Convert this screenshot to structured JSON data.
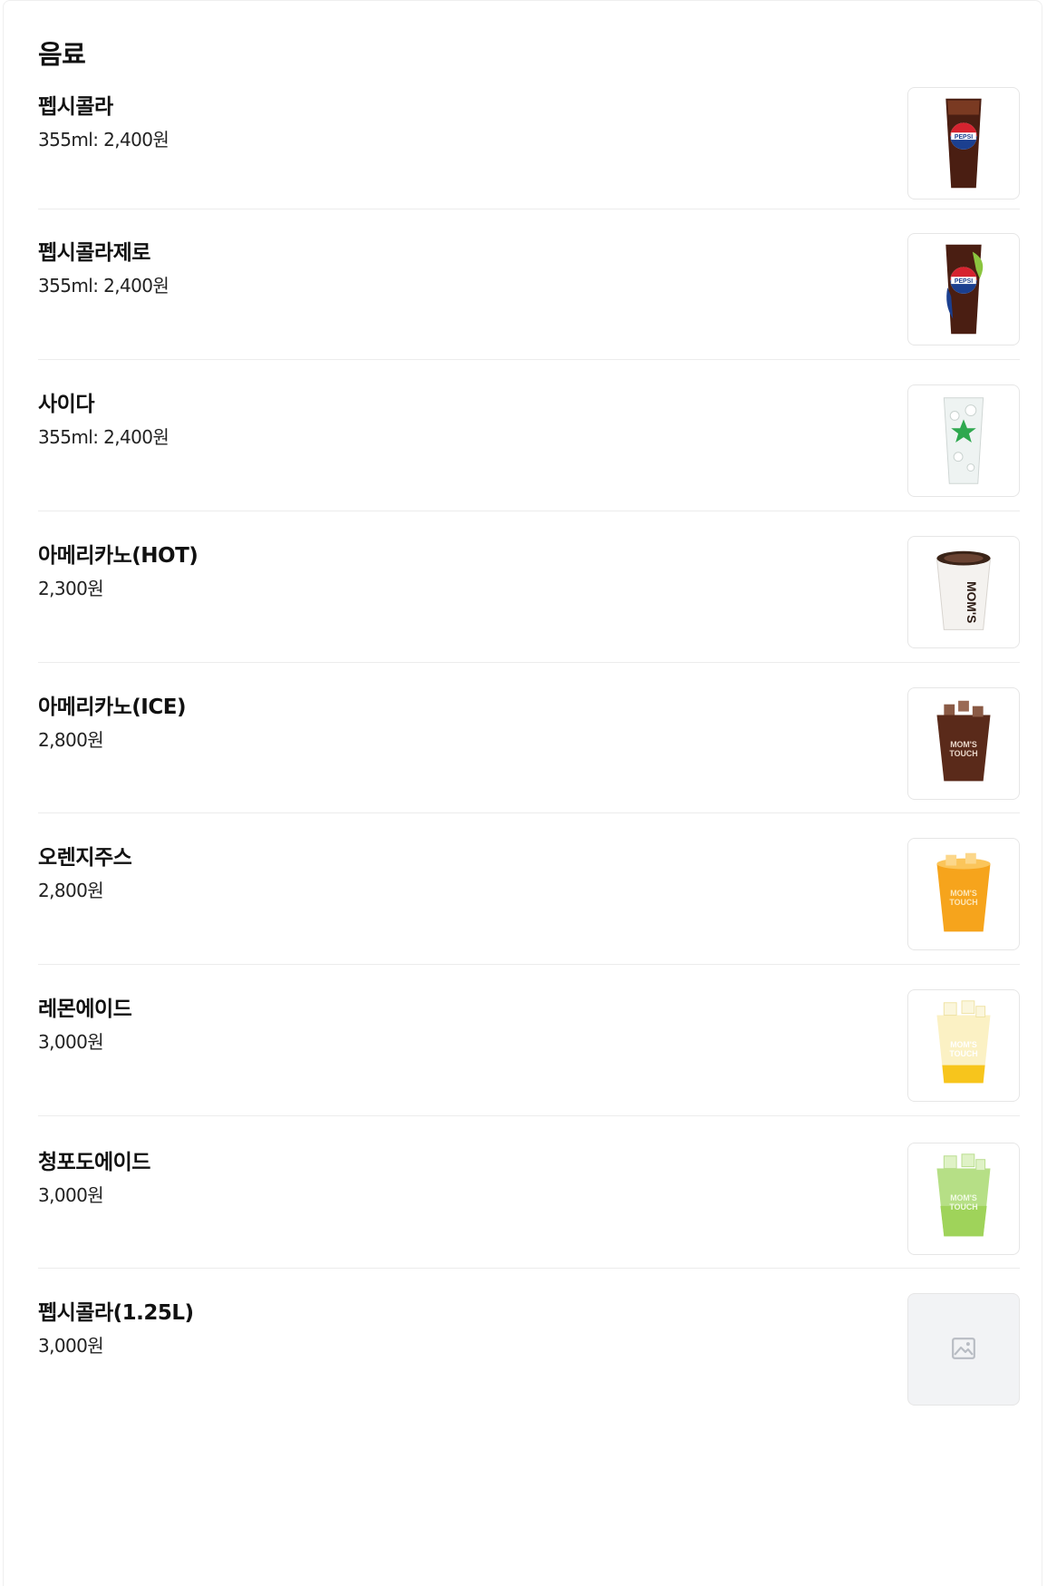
{
  "section": {
    "title": "음료"
  },
  "items": [
    {
      "name": "펩시콜라",
      "price": "355ml: 2,400원",
      "image": "pepsi-cup"
    },
    {
      "name": "펩시콜라제로",
      "price": "355ml: 2,400원",
      "image": "pepsi-zero-cup"
    },
    {
      "name": "사이다",
      "price": "355ml: 2,400원",
      "image": "cider-cup"
    },
    {
      "name": "아메리카노(HOT)",
      "price": "2,300원",
      "image": "hot-coffee-cup"
    },
    {
      "name": "아메리카노(ICE)",
      "price": "2,800원",
      "image": "iced-coffee-cup"
    },
    {
      "name": "오렌지주스",
      "price": "2,800원",
      "image": "orange-juice-cup"
    },
    {
      "name": "레몬에이드",
      "price": "3,000원",
      "image": "lemonade-cup"
    },
    {
      "name": "청포도에이드",
      "price": "3,000원",
      "image": "green-grape-ade-cup"
    },
    {
      "name": "펩시콜라(1.25L)",
      "price": "3,000원",
      "image": "image-placeholder-icon"
    }
  ],
  "colors": {
    "cola": "#4a1e12",
    "pepsi_blue": "#1b3f8f",
    "pepsi_red": "#d6232f",
    "coffee": "#5a2a1a",
    "orange": "#f6a41c",
    "lemon": "#f7e07a",
    "green_grape": "#9fd35a",
    "divider": "#ececec",
    "placeholder_bg": "#f2f3f5"
  }
}
